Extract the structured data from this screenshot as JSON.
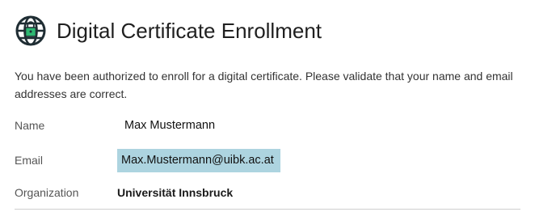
{
  "header": {
    "title": "Digital Certificate Enrollment",
    "icon": "globe-lock-icon"
  },
  "intro": {
    "text": "You have been authorized to enroll for a digital certificate. Please validate that your name and email addresses are correct."
  },
  "fields": {
    "name": {
      "label": "Name",
      "value": "Max Mustermann"
    },
    "email": {
      "label": "Email",
      "value": "Max.Mustermann@uibk.ac.at",
      "highlight_color": "#add4e0"
    },
    "organization": {
      "label": "Organization",
      "value": "Universität Innsbruck"
    }
  },
  "colors": {
    "icon_dark": "#1f2d33",
    "icon_accent": "#2eb872"
  }
}
